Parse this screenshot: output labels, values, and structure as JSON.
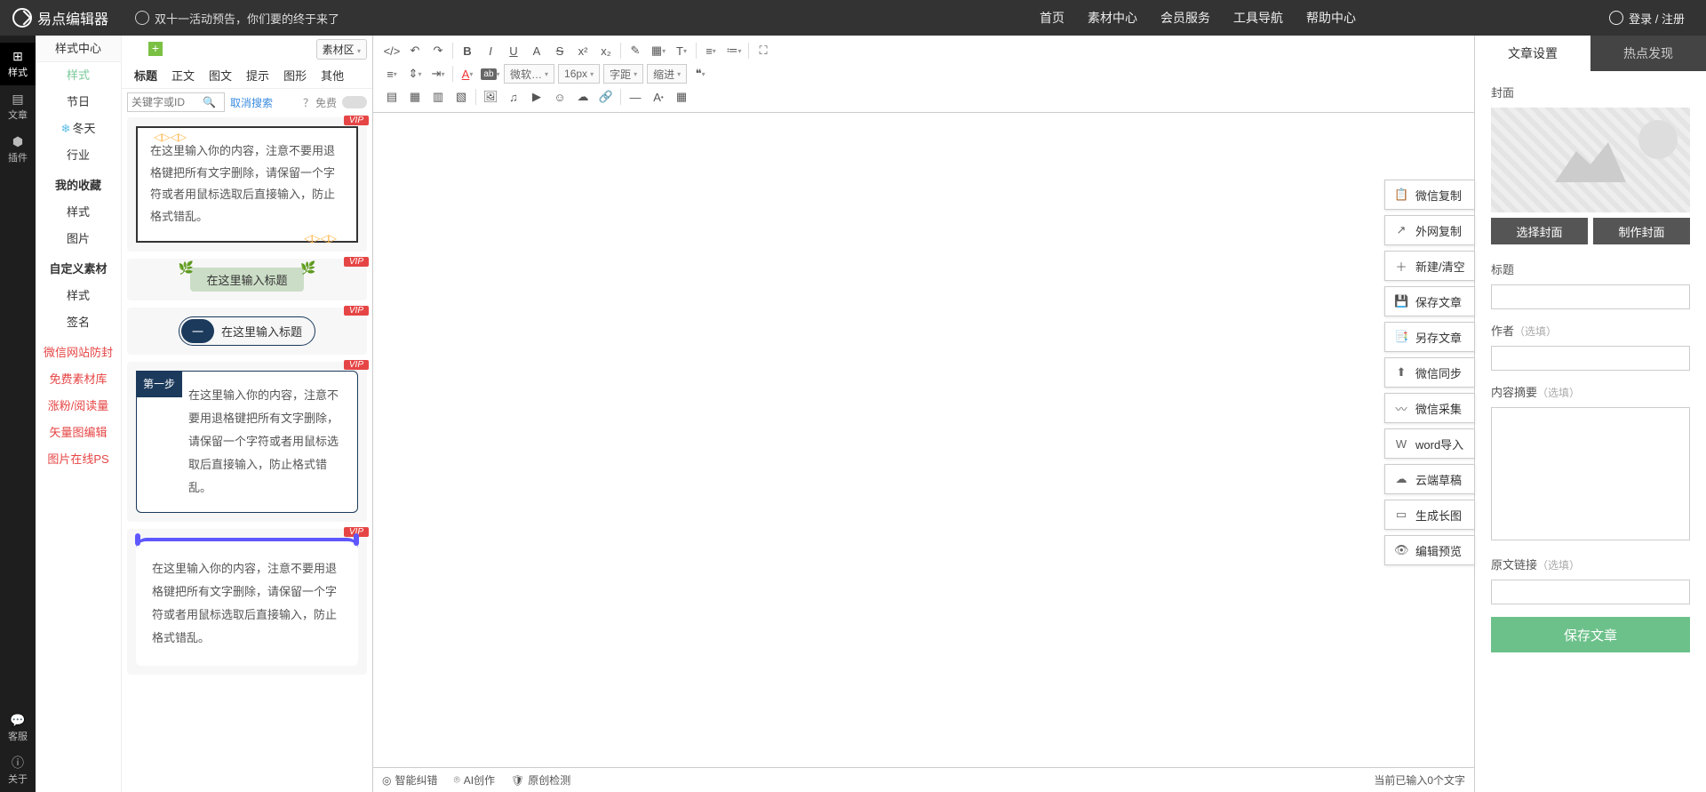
{
  "brand": "易点编辑器",
  "announcement": "双十一活动预告，你们要的终于来了",
  "topnav": [
    "首页",
    "素材中心",
    "会员服务",
    "工具导航",
    "帮助中心"
  ],
  "login": "登录 / 注册",
  "leftrail": {
    "style": "样式",
    "article": "文章",
    "plugin": "插件",
    "service": "客服",
    "about": "关于"
  },
  "sp": {
    "header": "样式中心",
    "side": {
      "style": "样式",
      "holiday": "节日",
      "winter": "冬天",
      "industry": "行业",
      "fav": "我的收藏",
      "style2": "样式",
      "image": "图片",
      "custom": "自定义素材",
      "style3": "样式",
      "sign": "签名",
      "red1": "微信网站防封",
      "red2": "免费素材库",
      "red3": "涨粉/阅读量",
      "red4": "矢量图编辑",
      "red5": "图片在线PS"
    },
    "zone": "素材区",
    "tabs": [
      "标题",
      "正文",
      "图文",
      "提示",
      "图形",
      "其他"
    ],
    "search_ph": "关键字或ID",
    "cancel": "取消搜索",
    "free": "免费",
    "vip": "VIP",
    "body_text": "在这里输入你的内容，注意不要用退格键把所有文字删除，请保留一个字符或者用鼠标选取后直接输入，防止格式错乱。",
    "title_text": "在这里输入标题",
    "step1": "第一步",
    "seq1": "一"
  },
  "tb_selects": {
    "font": "微软…",
    "size": "16px",
    "spacing": "字距",
    "indent": "缩进"
  },
  "float_buttons": {
    "wx_copy": "微信复制",
    "ext_copy": "外网复制",
    "new": "新建/清空",
    "save": "保存文章",
    "saveas": "另存文章",
    "wx_sync": "微信同步",
    "wx_collect": "微信采集",
    "word": "word导入",
    "cloud": "云端草稿",
    "longimg": "生成长图",
    "preview": "编辑预览"
  },
  "statusbar": {
    "correct": "智能纠错",
    "ai": "AI创作",
    "orig": "原创检测",
    "count": "当前已输入0个文字"
  },
  "rp": {
    "tab1": "文章设置",
    "tab2": "热点发现",
    "cover": "封面",
    "choose_cover": "选择封面",
    "make_cover": "制作封面",
    "title": "标题",
    "author": "作者",
    "summary": "内容摘要",
    "link": "原文链接",
    "optional": "（选填）",
    "save": "保存文章"
  },
  "colors": [
    "#645f5a",
    "#ad6e4a",
    "#c6322a",
    "#e64545",
    "#f08a3a",
    "#fbc02d",
    "#58c158",
    "#1dd1a1",
    "#1e88e5",
    "#6a4bcf",
    "#b03ba0",
    "#e63997"
  ]
}
